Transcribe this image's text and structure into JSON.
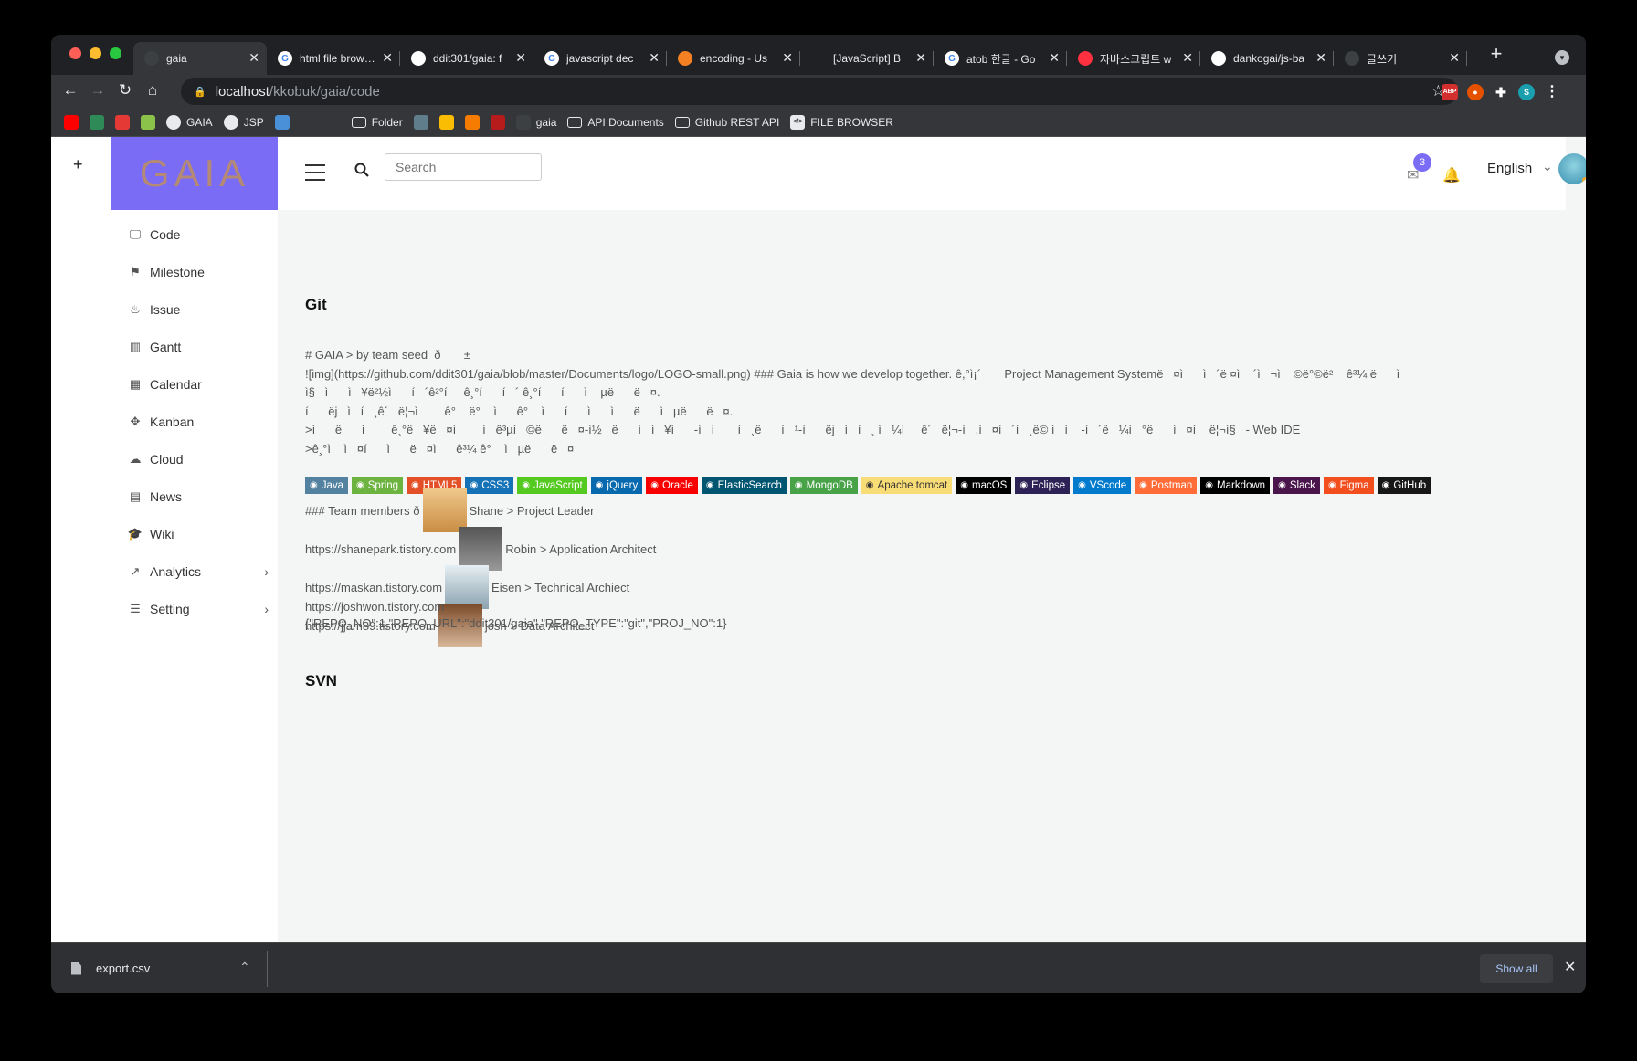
{
  "browser": {
    "tabs": [
      {
        "title": "gaia",
        "icon": "spinner-icon",
        "color": "#3c4043",
        "active": true
      },
      {
        "title": "html file browser",
        "icon": "google-icon",
        "color": "#ffffff"
      },
      {
        "title": "ddit301/gaia: f",
        "icon": "github-icon",
        "color": "#ffffff"
      },
      {
        "title": "javascript dec",
        "icon": "google-icon",
        "color": "#ffffff"
      },
      {
        "title": "encoding - Us",
        "icon": "stackoverflow-icon",
        "color": "#f48024"
      },
      {
        "title": "[JavaScript] B",
        "icon": "blank-icon",
        "color": "#202124"
      },
      {
        "title": "atob 한글 - Go",
        "icon": "google-icon",
        "color": "#ffffff"
      },
      {
        "title": "자바스크립트 w",
        "icon": "zum-icon",
        "color": "#ff3040"
      },
      {
        "title": "dankogai/js-ba",
        "icon": "github-icon",
        "color": "#ffffff"
      },
      {
        "title": "글쓰기",
        "icon": "tistory-icon",
        "color": "#3c4043"
      }
    ],
    "url_host": "localhost",
    "url_path": "/kkobuk/gaia/code",
    "bookmarks": [
      {
        "label": "",
        "icon": "youtube-icon",
        "color": "#ff0000"
      },
      {
        "label": "",
        "icon": "app-icon",
        "color": "#2e8b57"
      },
      {
        "label": "",
        "icon": "c-icon",
        "color": "#e53935"
      },
      {
        "label": "",
        "icon": "app-icon",
        "color": "#8bc34a"
      },
      {
        "label": "GAIA",
        "icon": "github-icon",
        "color": "#35363a"
      },
      {
        "label": "JSP",
        "icon": "github-icon",
        "color": "#35363a"
      },
      {
        "label": "",
        "icon": "globe-icon",
        "color": "#4a90d9"
      },
      {
        "label": "",
        "icon": "tistory-icon",
        "color": "#35363a"
      },
      {
        "label": "",
        "icon": "inv-icon",
        "color": "#35363a"
      },
      {
        "label": "Folder",
        "icon": "folder-icon",
        "color": "#35363a"
      },
      {
        "label": "",
        "icon": "app-icon",
        "color": "#607d8b"
      },
      {
        "label": "",
        "icon": "drive-icon",
        "color": "#fbbc04"
      },
      {
        "label": "",
        "icon": "chart-icon",
        "color": "#f57c00"
      },
      {
        "label": "",
        "icon": "app-icon",
        "color": "#b71c1c"
      },
      {
        "label": "gaia",
        "icon": "spinner-icon",
        "color": "#3c4043"
      },
      {
        "label": "API Documents",
        "icon": "folder-icon",
        "color": "#35363a"
      },
      {
        "label": "Github REST API",
        "icon": "folder-icon",
        "color": "#35363a"
      },
      {
        "label": "FILE BROWSER",
        "icon": "code-icon",
        "color": "#e8eaed"
      }
    ],
    "profile_initial": "S"
  },
  "app": {
    "logo_text": "GAIA",
    "search_placeholder": "Search",
    "mail_badge": "3",
    "language": "English",
    "sidebar": [
      {
        "label": "Code",
        "icon": "monitor-icon"
      },
      {
        "label": "Milestone",
        "icon": "signpost-icon"
      },
      {
        "label": "Issue",
        "icon": "fire-icon"
      },
      {
        "label": "Gantt",
        "icon": "bar-chart-icon"
      },
      {
        "label": "Calendar",
        "icon": "calendar-icon"
      },
      {
        "label": "Kanban",
        "icon": "move-icon"
      },
      {
        "label": "Cloud",
        "icon": "cloud-icon"
      },
      {
        "label": "News",
        "icon": "newspaper-icon"
      },
      {
        "label": "Wiki",
        "icon": "graduation-cap-icon"
      },
      {
        "label": "Analytics",
        "icon": "trend-icon",
        "chevron": true
      },
      {
        "label": "Setting",
        "icon": "menu-icon",
        "chevron": true
      }
    ]
  },
  "content": {
    "git_title": "Git",
    "readme_lines": [
      "# GAIA > by team seed  ð       ±",
      "![img](https://github.com/ddit301/gaia/blob/master/Documents/logo/LOGO-small.png) ### Gaia is how we develop together. ê,°ì¡´       Project Management Systemë   ¤ì      ì   ´ë ¤ì    ´ì   ¬ì    ©ë°©ë²    ê³¼ ë      ì",
      "ì§   ì      ì   ¥ë²½ì      í   ´ê²°í     ê¸°í      í   ´ ê¸°í      í      ì    µë      ë   ¤.",
      "í      ëj   ì   í   ¸ê´   ë¦¬ì        ê°    ë°    ì      ê°    ì      í      ì      ì      ë      ì   µë      ë   ¤.",
      ">ì      ë      ì        ê¸°ë   ¥ë   ¤ì        ì   ê³µí   ©ë      ë   ¤-ì½   ë      ì   ì   ¥ì      -ì   ì       í   ¸ë      í   ¹-í      ëj   ì   í   ¸ ì   ¼ì     ê´   ë¦¬-ì   ,ì   ¤í   ´í   ¸ë© ì   ì    -í   ´ë   ¼ì   °ë      ì   ¤í    ë¦¬ì§   - Web IDE",
      ">ê¸°ì    ì   ¤í      ì      ë   ¤ì      ê³¼ ê°    ì   µë      ë   ¤"
    ],
    "tech_badges": [
      {
        "label": "Java",
        "color": "#5382a1",
        "icon": "java-icon"
      },
      {
        "label": "Spring",
        "color": "#6db33f",
        "icon": "spring-icon"
      },
      {
        "label": "HTML5",
        "color": "#e34f26",
        "icon": "html5-icon"
      },
      {
        "label": "CSS3",
        "color": "#1572b6",
        "icon": "css3-icon"
      },
      {
        "label": "JavaScript",
        "color": "#54c91f",
        "icon": "javascript-icon"
      },
      {
        "label": "jQuery",
        "color": "#0769ad",
        "icon": "jquery-icon"
      },
      {
        "label": "Oracle",
        "color": "#f80000",
        "icon": "oracle-icon"
      },
      {
        "label": "ElasticSearch",
        "color": "#005571",
        "icon": "elasticsearch-icon"
      },
      {
        "label": "MongoDB",
        "color": "#47a248",
        "icon": "mongodb-icon"
      },
      {
        "label": "Apache tomcat",
        "color": "#f8dc75",
        "icon": "tomcat-icon",
        "dark": true
      },
      {
        "label": "macOS",
        "color": "#000000",
        "icon": "apple-icon"
      },
      {
        "label": "Eclipse",
        "color": "#2c2255",
        "icon": "eclipse-icon"
      },
      {
        "label": "VScode",
        "color": "#007acc",
        "icon": "vscode-icon"
      },
      {
        "label": "Postman",
        "color": "#ff6c37",
        "icon": "postman-icon"
      },
      {
        "label": "Markdown",
        "color": "#000000",
        "icon": "markdown-icon"
      },
      {
        "label": "Slack",
        "color": "#4a154b",
        "icon": "slack-icon"
      },
      {
        "label": "Figma",
        "color": "#f24e1e",
        "icon": "figma-icon"
      },
      {
        "label": "GitHub",
        "color": "#181717",
        "icon": "github-icon"
      }
    ],
    "members": [
      {
        "prefix": "### Team members ð",
        "name": "Shane > Project Leader"
      },
      {
        "prefix": "https://shanepark.tistory.com",
        "name": "Robin > Application Architect"
      },
      {
        "prefix": "https://maskan.tistory.com",
        "name": "Eisen > Technical Archiect"
      },
      {
        "prefix": "https://jjam89.tistory.com",
        "name": "josh > Data Architect"
      }
    ],
    "last_link": "https://joshwon.tistory.com",
    "repo_json": "{\"REPO_NO\":1,\"REPO_URL\":\"ddit301/gaia\",\"REPO_TYPE\":\"git\",\"PROJ_NO\":1}",
    "svn_title": "SVN"
  },
  "downloads": {
    "file_name": "export.csv",
    "show_all": "Show all"
  }
}
